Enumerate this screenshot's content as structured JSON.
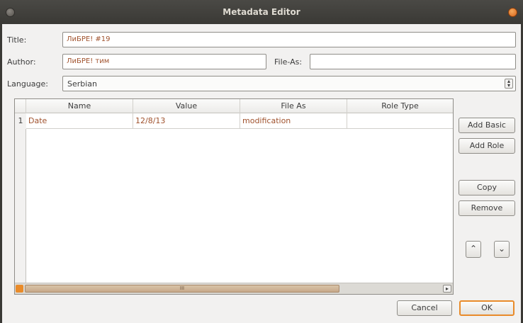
{
  "window": {
    "title": "Metadata Editor"
  },
  "form": {
    "title_label": "Title:",
    "title_value": "ЛиБРЕ! #19",
    "author_label": "Author:",
    "author_value": "ЛиБРЕ! тим",
    "file_as_label": "File-As:",
    "file_as_value": "",
    "language_label": "Language:",
    "language_value": "Serbian"
  },
  "table": {
    "columns": [
      "Name",
      "Value",
      "File As",
      "Role Type"
    ],
    "rows": [
      {
        "num": "1",
        "name": "Date",
        "value": "12/8/13",
        "file_as": "modification",
        "role_type": ""
      }
    ],
    "scroll_thumb": "III"
  },
  "side_buttons": {
    "add_basic": "Add Basic",
    "add_role": "Add Role",
    "copy": "Copy",
    "remove": "Remove",
    "up": "^",
    "down": "v"
  },
  "footer": {
    "cancel": "Cancel",
    "ok": "OK"
  }
}
